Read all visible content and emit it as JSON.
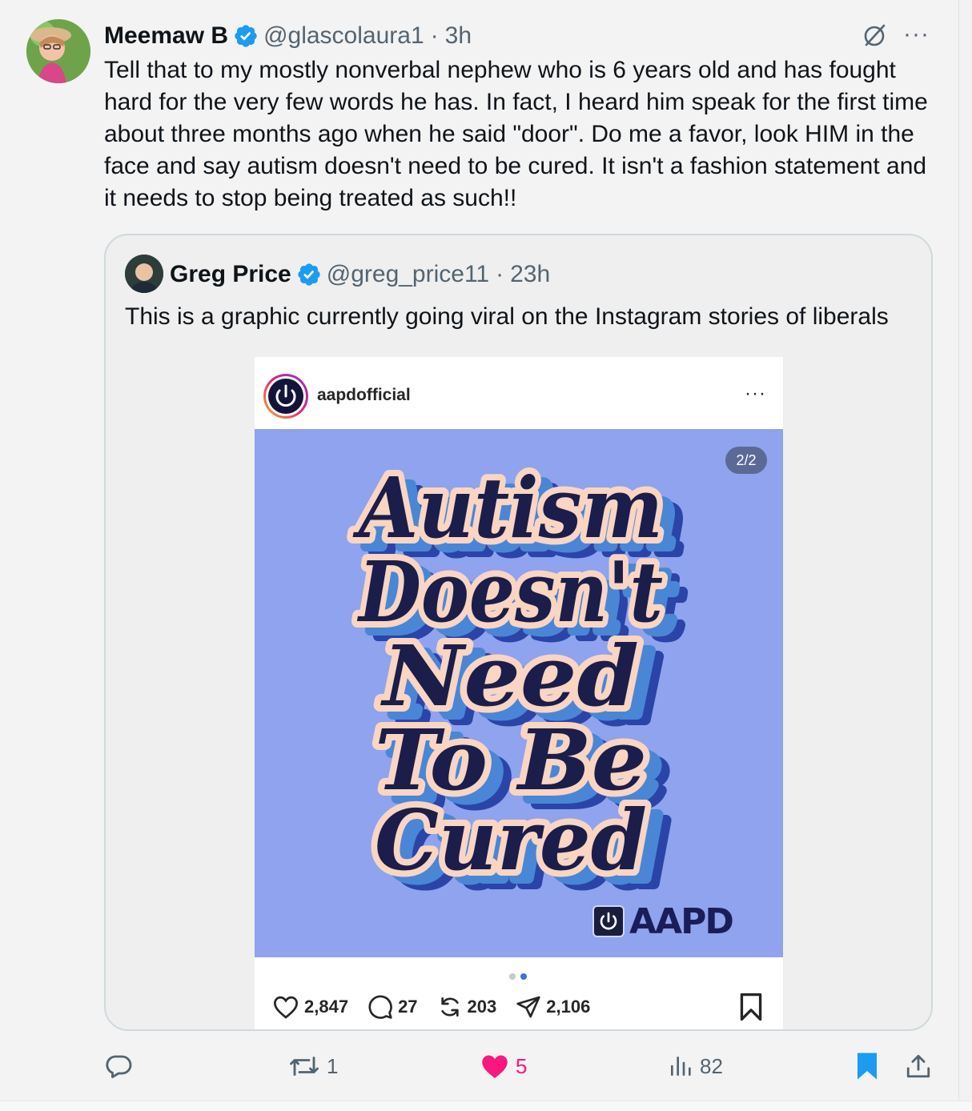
{
  "tweet": {
    "author_name": "Meemaw B",
    "handle": "@glascolaura1",
    "separator": "·",
    "time": "3h",
    "text": "Tell that to my mostly nonverbal nephew who is 6 years old and has fought hard for the very few words he has. In fact, I heard him speak for the first time about three months ago when he said \"door\". Do me a favor, look HIM in the face and say autism doesn't need to be cured. It isn't a fashion statement and it needs to stop being treated as such!!",
    "more_icon": "···"
  },
  "quoted": {
    "author_name": "Greg Price",
    "handle": "@greg_price11",
    "separator": "·",
    "time": "23h",
    "text": "This is a graphic currently going viral on the Instagram stories of liberals"
  },
  "instagram": {
    "username": "aapdofficial",
    "more_icon": "···",
    "counter": "2/2",
    "poster_lines": [
      "Autism",
      "Doesn't",
      "Need",
      "To Be",
      "Cured"
    ],
    "brand": "AAPD",
    "likes": "2,847",
    "comments": "27",
    "reposts": "203",
    "shares": "2,106",
    "carousel_dots": 2,
    "active_dot": 2
  },
  "actions": {
    "replies": "",
    "reposts": "1",
    "likes": "5",
    "views": "82"
  },
  "colors": {
    "like": "#f91880",
    "verified": "#1d9bf0",
    "bookmark_active": "#1d9bf0",
    "poster_bg": "#8fa3ee",
    "poster_text": "#1b1d4a",
    "poster_outline": "#f9d5c2"
  }
}
